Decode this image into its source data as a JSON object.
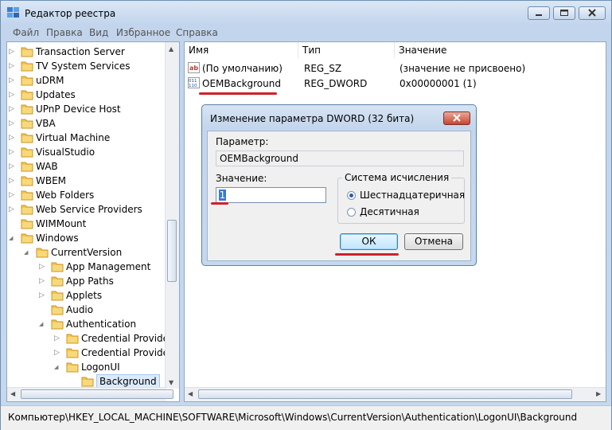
{
  "window": {
    "title": "Редактор реестра"
  },
  "menu": [
    "Файл",
    "Правка",
    "Вид",
    "Избранное",
    "Справка"
  ],
  "tree": {
    "items": [
      {
        "label": "Transaction Server",
        "level": 0,
        "expander": "collapsed"
      },
      {
        "label": "TV System Services",
        "level": 0,
        "expander": "collapsed"
      },
      {
        "label": "uDRM",
        "level": 0,
        "expander": "collapsed"
      },
      {
        "label": "Updates",
        "level": 0,
        "expander": "collapsed"
      },
      {
        "label": "UPnP Device Host",
        "level": 0,
        "expander": "collapsed"
      },
      {
        "label": "VBA",
        "level": 0,
        "expander": "collapsed"
      },
      {
        "label": "Virtual Machine",
        "level": 0,
        "expander": "collapsed"
      },
      {
        "label": "VisualStudio",
        "level": 0,
        "expander": "collapsed"
      },
      {
        "label": "WAB",
        "level": 0,
        "expander": "collapsed"
      },
      {
        "label": "WBEM",
        "level": 0,
        "expander": "collapsed"
      },
      {
        "label": "Web Folders",
        "level": 0,
        "expander": "collapsed"
      },
      {
        "label": "Web Service Providers",
        "level": 0,
        "expander": "collapsed"
      },
      {
        "label": "WIMMount",
        "level": 0,
        "expander": "none"
      },
      {
        "label": "Windows",
        "level": 0,
        "expander": "expanded"
      },
      {
        "label": "CurrentVersion",
        "level": 1,
        "expander": "expanded"
      },
      {
        "label": "App Management",
        "level": 2,
        "expander": "collapsed"
      },
      {
        "label": "App Paths",
        "level": 2,
        "expander": "collapsed"
      },
      {
        "label": "Applets",
        "level": 2,
        "expander": "collapsed"
      },
      {
        "label": "Audio",
        "level": 2,
        "expander": "none"
      },
      {
        "label": "Authentication",
        "level": 2,
        "expander": "expanded"
      },
      {
        "label": "Credential Provider",
        "level": 3,
        "expander": "collapsed"
      },
      {
        "label": "Credential Providers",
        "level": 3,
        "expander": "collapsed"
      },
      {
        "label": "LogonUI",
        "level": 3,
        "expander": "expanded"
      },
      {
        "label": "Background",
        "level": 4,
        "expander": "none",
        "selected": true
      }
    ]
  },
  "list": {
    "columns": [
      "Имя",
      "Тип",
      "Значение"
    ],
    "rows": [
      {
        "icon": "string-value-icon",
        "name": "(По умолчанию)",
        "type": "REG_SZ",
        "value": "(значение не присвоено)"
      },
      {
        "icon": "binary-value-icon",
        "name": "OEMBackground",
        "type": "REG_DWORD",
        "value": "0x00000001 (1)"
      }
    ]
  },
  "statusbar": {
    "path": "Компьютер\\HKEY_LOCAL_MACHINE\\SOFTWARE\\Microsoft\\Windows\\CurrentVersion\\Authentication\\LogonUI\\Background"
  },
  "dialog": {
    "title": "Изменение параметра DWORD (32 бита)",
    "param_label": "Параметр:",
    "param_value": "OEMBackground",
    "value_label": "Значение:",
    "value": "1",
    "base_group": "Система исчисления",
    "radio_hex": "Шестнадцатеричная",
    "radio_dec": "Десятичная",
    "selected_base": "hex",
    "ok": "ОК",
    "cancel": "Отмена"
  },
  "colors": {
    "highlight": "#d0202a",
    "selection": "#dcebfc",
    "folder": "#f3c54a"
  }
}
